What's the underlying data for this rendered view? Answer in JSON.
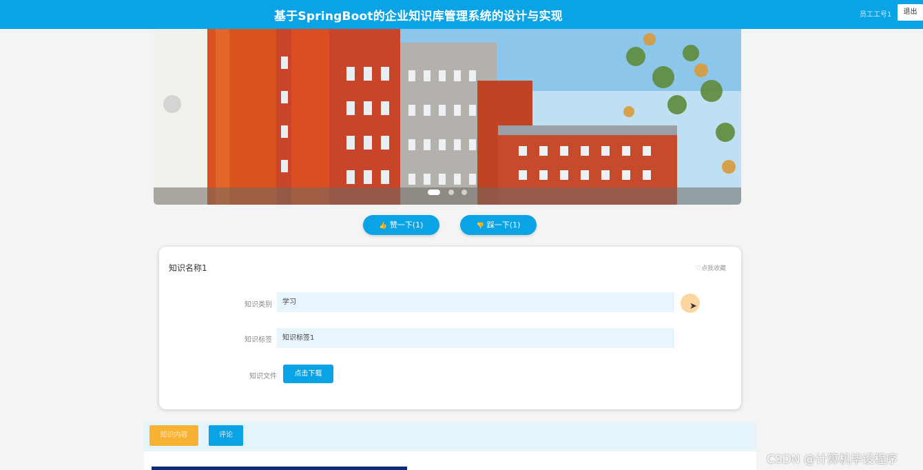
{
  "header": {
    "title": "基于SpringBoot的企业知识库管理系统的设计与实现",
    "user": "员工工号1",
    "logout_label": "退出"
  },
  "banner": {
    "slides": 3,
    "active_slide": 1
  },
  "actions": {
    "like_label": "赞一下(1)",
    "dislike_label": "踩一下(1)"
  },
  "detail": {
    "name": "知识名称1",
    "favorite_label": "点我收藏",
    "category_label": "知识类别",
    "category_value": "学习",
    "tag_label": "知识标签",
    "tag_value": "知识标签1",
    "file_label": "知识文件",
    "download_label": "点击下载"
  },
  "tabs": {
    "content_label": "知识内容",
    "comment_label": "评论"
  },
  "watermark": "CSDN @计算机毕设程序"
}
